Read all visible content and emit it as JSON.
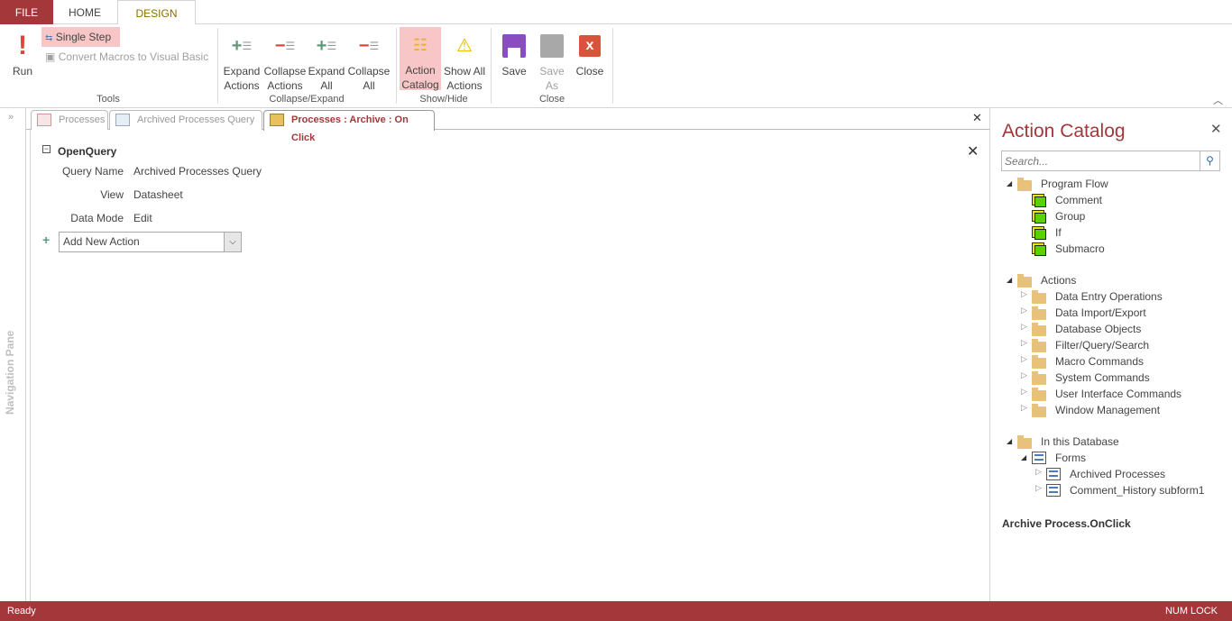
{
  "ribbon": {
    "tabs": [
      "FILE",
      "HOME",
      "DESIGN"
    ],
    "run": "Run",
    "single_step": "Single Step",
    "convert": "Convert Macros to Visual Basic",
    "expand_actions": [
      "Expand",
      "Actions"
    ],
    "collapse_actions": [
      "Collapse",
      "Actions"
    ],
    "expand_all": [
      "Expand",
      "All"
    ],
    "collapse_all": [
      "Collapse",
      "All"
    ],
    "action_catalog": [
      "Action",
      "Catalog"
    ],
    "show_all": [
      "Show All",
      "Actions"
    ],
    "save": "Save",
    "save_as": [
      "Save",
      "As"
    ],
    "close": "Close",
    "groups": [
      "Tools",
      "Collapse/Expand",
      "Show/Hide",
      "Close"
    ]
  },
  "nav": {
    "label": "Navigation Pane"
  },
  "doc_tabs": [
    "Processes",
    "Archived Processes Query",
    "Processes : Archive : On Click"
  ],
  "editor": {
    "action": "OpenQuery",
    "args": [
      {
        "label": "Query Name",
        "value": "Archived Processes Query"
      },
      {
        "label": "View",
        "value": "Datasheet"
      },
      {
        "label": "Data Mode",
        "value": "Edit"
      }
    ],
    "add_new": "Add New Action"
  },
  "catalog": {
    "title": "Action Catalog",
    "search_placeholder": "Search...",
    "program_flow": "Program Flow",
    "flow_items": [
      "Comment",
      "Group",
      "If",
      "Submacro"
    ],
    "actions": "Actions",
    "action_items": [
      "Data Entry Operations",
      "Data Import/Export",
      "Database Objects",
      "Filter/Query/Search",
      "Macro Commands",
      "System Commands",
      "User Interface Commands",
      "Window Management"
    ],
    "in_db": "In this Database",
    "forms": "Forms",
    "form_items": [
      "Archived Processes",
      "Comment_History subform1"
    ],
    "context": "Archive Process.OnClick"
  },
  "status": {
    "left": "Ready",
    "right": "NUM LOCK"
  },
  "colors": {
    "accent": "#a4373a",
    "highlight": "#f8c6c6"
  }
}
